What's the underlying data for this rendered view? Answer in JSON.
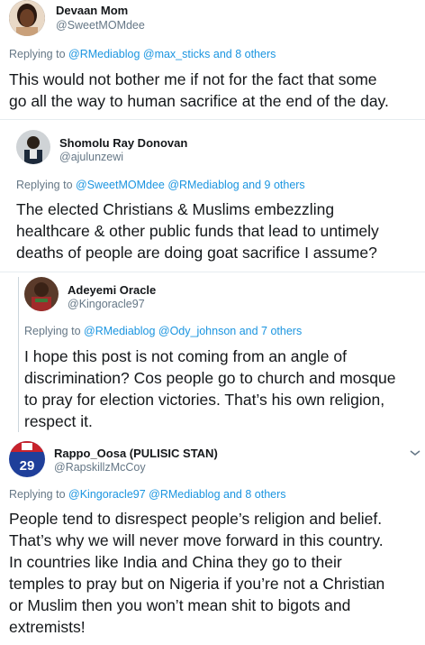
{
  "tweets": [
    {
      "name": "Devaan Mom",
      "handle": "@SweetMOMdee",
      "replying_prefix": "Replying to ",
      "replying_links": "@RMediablog @max_sticks",
      "replying_suffix": " and 8 others",
      "lines": [
        "This would not bother me if not for the fact that some",
        "go all the way to human sacrifice at the end of the day."
      ]
    },
    {
      "name": "Shomolu Ray Donovan",
      "handle": "@ajulunzewi",
      "replying_prefix": "Replying to ",
      "replying_links": "@SweetMOMdee @RMediablog",
      "replying_suffix": " and 9 others",
      "lines": [
        "The elected Christians & Muslims embezzling",
        "healthcare & other public funds that lead to untimely",
        "deaths of people are doing goat sacrifice I assume?"
      ]
    },
    {
      "name": "Adeyemi Oracle",
      "handle": "@Kingoracle97",
      "replying_prefix": "Replying to ",
      "replying_links": "@RMediablog @Ody_johnson",
      "replying_suffix": " and 7 others",
      "lines": [
        "I hope this post is not coming from an angle of",
        "discrimination? Cos people go to church and mosque",
        "to pray for election victories. That’s his own religion,",
        "respect it."
      ]
    },
    {
      "name": "Rappo_Oosa (PULISIC STAN)",
      "handle": "@RapskillzMcCoy",
      "jersey_number": "29",
      "replying_prefix": "Replying to ",
      "replying_links": "@Kingoracle97 @RMediablog",
      "replying_suffix": " and 8 others",
      "lines": [
        "People tend to disrespect people’s religion and belief.",
        "That’s why we will never move forward in this country.",
        "In countries like India and China they go to their",
        "temples to pray but on Nigeria if you’re not a Christian",
        "or Muslim then you won’t mean shit to bigots and",
        "extremists!"
      ]
    }
  ],
  "icons": {
    "more": "chevron-down-icon"
  },
  "colors": {
    "link": "#1b95e0",
    "secondary_text": "#657786",
    "thread_line": "#ccd6dd"
  }
}
